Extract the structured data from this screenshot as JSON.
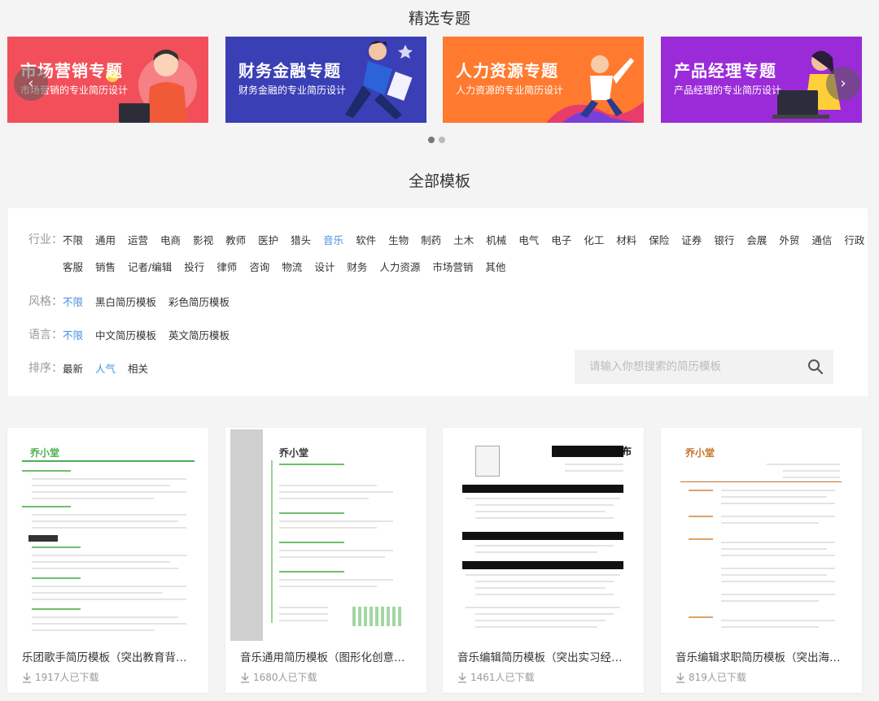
{
  "featured": {
    "title": "精选专题",
    "banners": [
      {
        "title": "市场营销专题",
        "subtitle": "市场营销的专业简历设计",
        "color": "#f24f5a"
      },
      {
        "title": "财务金融专题",
        "subtitle": "财务金融的专业简历设计",
        "color": "#3a3fb5"
      },
      {
        "title": "人力资源专题",
        "subtitle": "人力资源的专业简历设计",
        "color": "#ff7a2f"
      },
      {
        "title": "产品经理专题",
        "subtitle": "产品经理的专业简历设计",
        "color": "#9b2bd8"
      }
    ],
    "prev_icon": "‹",
    "next_icon": "›"
  },
  "all": {
    "title": "全部模板"
  },
  "filters": {
    "industry": {
      "label": "行业：",
      "row1": [
        "不限",
        "通用",
        "运营",
        "电商",
        "影视",
        "教师",
        "医护",
        "猎头",
        "音乐",
        "软件",
        "生物",
        "制药",
        "土木",
        "机械",
        "电气",
        "电子",
        "化工",
        "材料",
        "保险",
        "证券",
        "银行",
        "会展",
        "外贸",
        "通信",
        "行政"
      ],
      "row2": [
        "客服",
        "销售",
        "记者/编辑",
        "投行",
        "律师",
        "咨询",
        "物流",
        "设计",
        "财务",
        "人力资源",
        "市场营销",
        "其他"
      ],
      "active": "音乐"
    },
    "style": {
      "label": "风格：",
      "options": [
        "不限",
        "黑白简历模板",
        "彩色简历模板"
      ],
      "active": "不限"
    },
    "language": {
      "label": "语言：",
      "options": [
        "不限",
        "中文简历模板",
        "英文简历模板"
      ],
      "active": "不限"
    },
    "sort": {
      "label": "排序：",
      "options": [
        "最新",
        "人气",
        "相关"
      ],
      "active": "人气"
    },
    "search": {
      "placeholder": "请输入你想搜索的简历模板"
    }
  },
  "cards": [
    {
      "title": "乐团歌手简历模板（突出教育背景，…",
      "downloads": "1917人已下载",
      "name": "乔小堂"
    },
    {
      "title": "音乐通用简历模板（图形化创意简历…",
      "downloads": "1680人已下载",
      "name": "乔小堂"
    },
    {
      "title": "音乐编辑简历模板（突出实习经历）",
      "downloads": "1461人已下载",
      "name": "乔小布"
    },
    {
      "title": "音乐编辑求职简历模板（突出海外交…",
      "downloads": "819人已下载",
      "name": "乔小堂"
    }
  ]
}
